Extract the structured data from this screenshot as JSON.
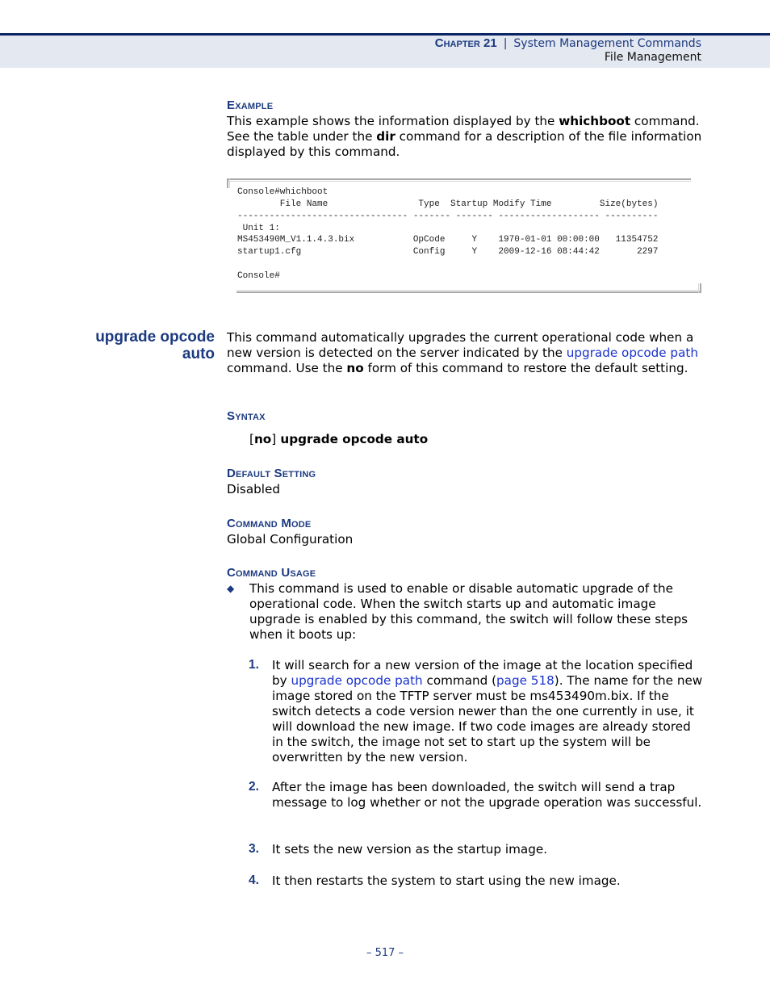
{
  "header": {
    "chapter_label": "Chapter 21",
    "separator": "|",
    "section": "System Management Commands",
    "subsection": "File Management"
  },
  "example": {
    "heading": "Example",
    "text_before": "This example shows the information displayed by the ",
    "bold1": "whichboot",
    "text_middle": " command. See the table under the ",
    "bold2": "dir",
    "text_after": " command for a description of the file information displayed by this command."
  },
  "console": {
    "lines": [
      "Console#whichboot",
      "        File Name                 Type  Startup Modify Time         Size(bytes)",
      "-------------------------------- ------- ------- ------------------- ----------",
      " Unit 1:",
      "MS453490M_V1.1.4.3.bix           OpCode     Y    1970-01-01 00:00:00   11354752",
      "startup1.cfg                     Config     Y    2009-12-16 08:44:42       2297",
      "",
      "Console#"
    ],
    "columns": [
      "File Name",
      "Type",
      "Startup",
      "Modify Time",
      "Size(bytes)"
    ],
    "unit": "Unit 1:",
    "rows": [
      {
        "file": "MS453490M_V1.1.4.3.bix",
        "type": "OpCode",
        "startup": "Y",
        "modify_time": "1970-01-01 00:00:00",
        "size": "11354752"
      },
      {
        "file": "startup1.cfg",
        "type": "Config",
        "startup": "Y",
        "modify_time": "2009-12-16 08:44:42",
        "size": "2297"
      }
    ]
  },
  "command": {
    "title_line1": "upgrade opcode",
    "title_line2": "auto",
    "desc_part1": "This command automatically upgrades the current operational code when a new version is detected on the server indicated by the ",
    "desc_link": "upgrade opcode path",
    "desc_part2": " command. Use the ",
    "desc_bold": "no",
    "desc_part3": " form of this command to restore the default setting."
  },
  "syntax": {
    "heading": "Syntax",
    "open_bracket": "[",
    "no_kw": "no",
    "close_bracket": "]",
    "command": " upgrade opcode auto"
  },
  "default_setting": {
    "heading": "Default Setting",
    "value": "Disabled"
  },
  "command_mode": {
    "heading": "Command Mode",
    "value": "Global Configuration"
  },
  "command_usage": {
    "heading": "Command Usage",
    "bullet_glyph": "◆",
    "bullet_text": "This command is used to enable or disable automatic upgrade of the operational code. When the switch starts up and automatic image upgrade is enabled by this command, the switch will follow these steps when it boots up:",
    "steps": [
      {
        "num": "1.",
        "text_a": "It will search for a new version of the image at the location specified by ",
        "link1": "upgrade opcode path",
        "text_b": " command (",
        "link2": "page 518",
        "text_c": "). The name for the new image stored on the TFTP server must be ms453490m.bix. If the switch detects a code version newer than the one currently in use, it will download the new image. If two code images are already stored in the switch, the image not set to start up the system will be overwritten by the new version."
      },
      {
        "num": "2.",
        "text": "After the image has been downloaded, the switch will send a trap message to log whether or not the upgrade operation was successful."
      },
      {
        "num": "3.",
        "text": "It sets the new version as the startup image."
      },
      {
        "num": "4.",
        "text": "It then restarts the system to start using the new image."
      }
    ]
  },
  "footer": {
    "page_number": "–  517  –"
  }
}
